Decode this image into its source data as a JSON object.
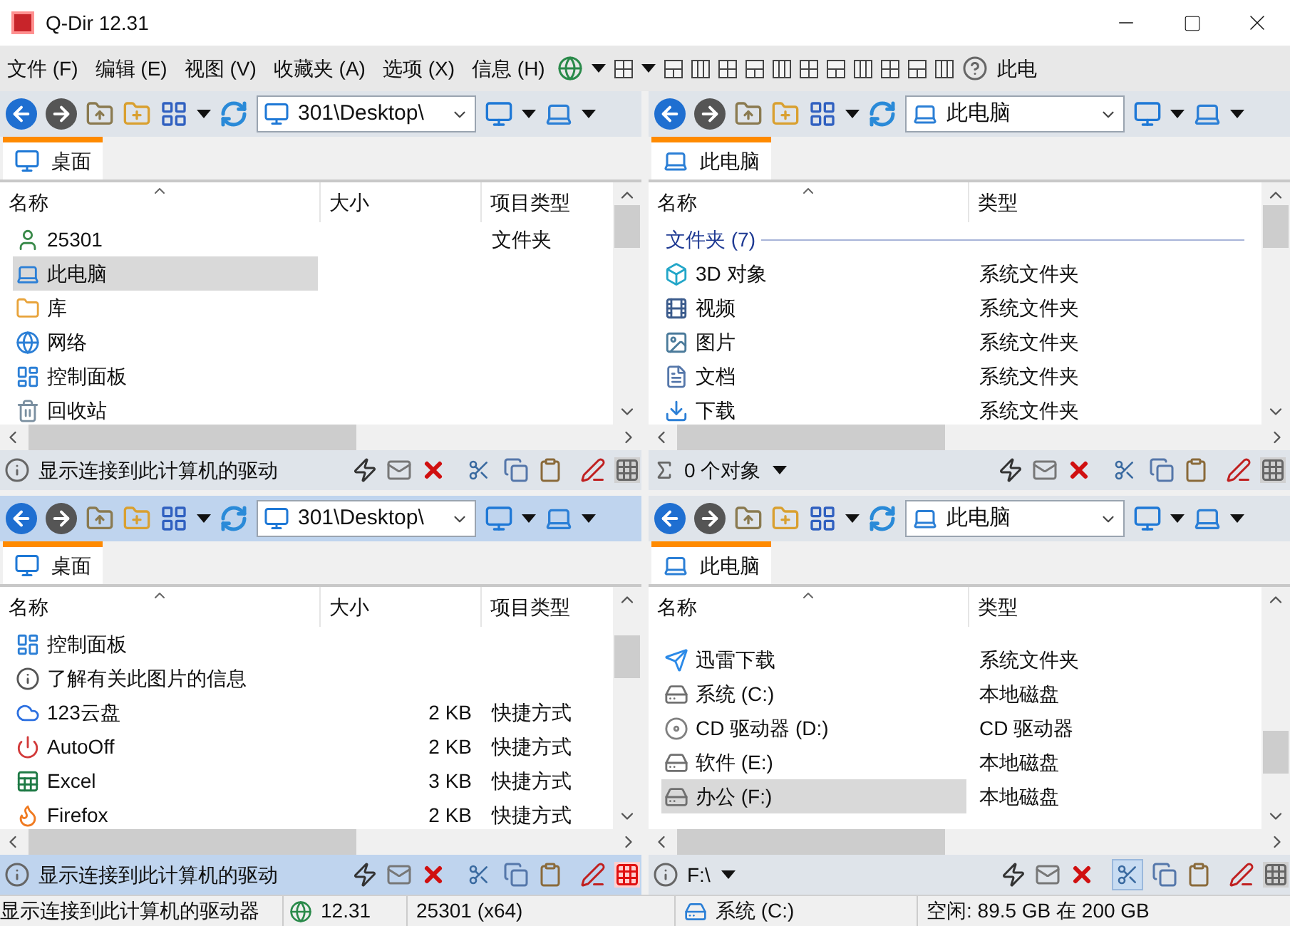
{
  "window": {
    "title": "Q-Dir 12.31"
  },
  "menu": [
    "文件 (F)",
    "编辑 (E)",
    "视图 (V)",
    "收藏夹 (A)",
    "选项 (X)",
    "信息 (H)"
  ],
  "menu_toolbar": {
    "shortcut_label": "此电"
  },
  "panes": [
    {
      "active": false,
      "address": "301\\Desktop\\",
      "tab": {
        "label": "桌面",
        "selected": true
      },
      "columns": [
        "名称",
        "大小",
        "项目类型"
      ],
      "rows": [
        {
          "kind": "item",
          "name": "25301",
          "type": "文件夹",
          "selected": false
        },
        {
          "kind": "item",
          "name": "此电脑",
          "selected": true
        },
        {
          "kind": "item",
          "name": "库",
          "selected": false
        },
        {
          "kind": "item",
          "name": "网络",
          "selected": false
        },
        {
          "kind": "item",
          "name": "控制面板",
          "selected": false
        },
        {
          "kind": "item",
          "name": "回收站",
          "selected": false
        }
      ],
      "footer": {
        "kind": "info",
        "text": "显示连接到此计算机的驱动"
      },
      "cut_pressed": false
    },
    {
      "active": false,
      "address": "此电脑",
      "tab": {
        "label": "此电脑",
        "selected": true
      },
      "columns": [
        "名称",
        "类型"
      ],
      "rows": [
        {
          "kind": "group",
          "name": "文件夹 (7)"
        },
        {
          "kind": "item",
          "name": "3D 对象",
          "type": "系统文件夹",
          "selected": false
        },
        {
          "kind": "item",
          "name": "视频",
          "type": "系统文件夹",
          "selected": false
        },
        {
          "kind": "item",
          "name": "图片",
          "type": "系统文件夹",
          "selected": false
        },
        {
          "kind": "item",
          "name": "文档",
          "type": "系统文件夹",
          "selected": false
        },
        {
          "kind": "item",
          "name": "下载",
          "type": "系统文件夹",
          "selected": false
        }
      ],
      "footer": {
        "kind": "sum",
        "text": "0 个对象"
      },
      "cut_pressed": false
    },
    {
      "active": true,
      "address": "301\\Desktop\\",
      "tab": {
        "label": "桌面",
        "selected": true
      },
      "columns": [
        "名称",
        "大小",
        "项目类型"
      ],
      "rows": [
        {
          "kind": "item",
          "name": "控制面板",
          "selected": false
        },
        {
          "kind": "item",
          "name": "了解有关此图片的信息",
          "selected": false
        },
        {
          "kind": "item",
          "name": "123云盘",
          "size": "2 KB",
          "type": "快捷方式",
          "selected": false
        },
        {
          "kind": "item",
          "name": "AutoOff",
          "size": "2 KB",
          "type": "快捷方式",
          "selected": false
        },
        {
          "kind": "item",
          "name": "Excel",
          "size": "3 KB",
          "type": "快捷方式",
          "selected": false
        },
        {
          "kind": "item",
          "name": "Firefox",
          "size": "2 KB",
          "type": "快捷方式",
          "selected": false
        }
      ],
      "footer": {
        "kind": "info",
        "text": "显示连接到此计算机的驱动"
      },
      "cut_pressed": false
    },
    {
      "active": false,
      "address": "此电脑",
      "tab": {
        "label": "此电脑",
        "selected": true
      },
      "columns": [
        "名称",
        "类型"
      ],
      "rows": [
        {
          "kind": "item",
          "name": "迅雷下载",
          "type": "系统文件夹",
          "selected": false
        },
        {
          "kind": "item",
          "name": "系统 (C:)",
          "type": "本地磁盘",
          "selected": false
        },
        {
          "kind": "item",
          "name": "CD 驱动器 (D:)",
          "type": "CD 驱动器",
          "selected": false
        },
        {
          "kind": "item",
          "name": "软件 (E:)",
          "type": "本地磁盘",
          "selected": false
        },
        {
          "kind": "item",
          "name": "办公 (F:)",
          "type": "本地磁盘",
          "selected": true
        }
      ],
      "footer": {
        "kind": "path",
        "text": "F:\\"
      },
      "cut_pressed": true
    }
  ],
  "status_bar": {
    "message": "显示连接到此计算机的驱动器",
    "version": "12.31",
    "build": "25301 (x64)",
    "drive": "系统 (C:)",
    "free_space": "空闲: 89.5 GB 在 200 GB"
  }
}
